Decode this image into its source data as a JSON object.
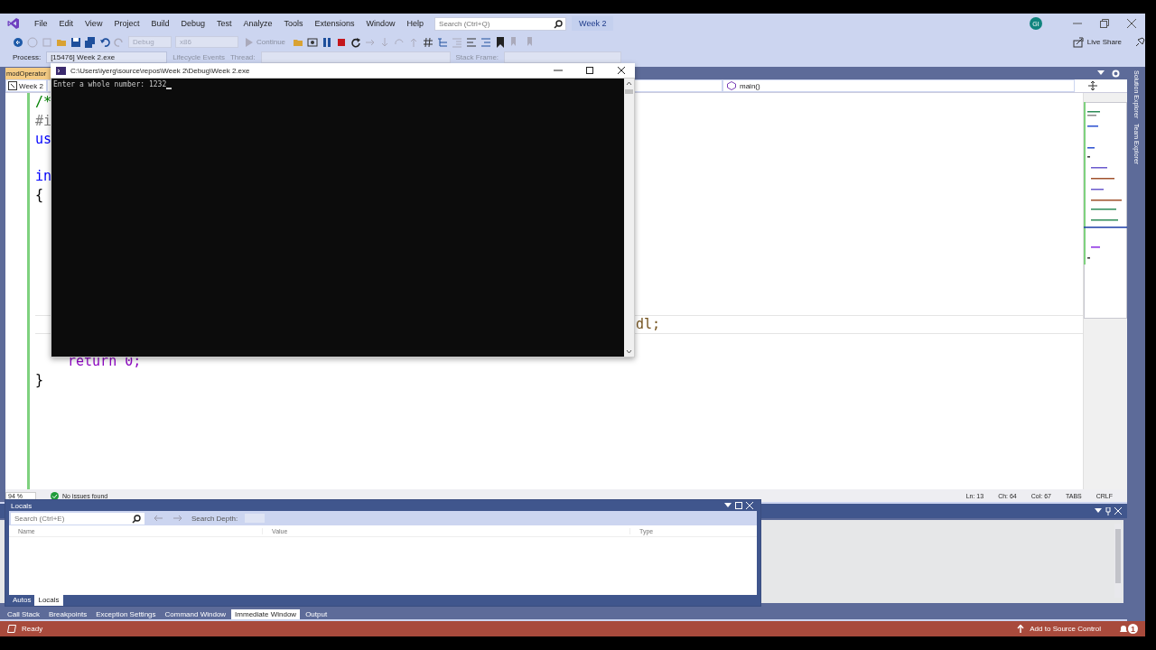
{
  "window": {
    "menu": [
      "File",
      "Edit",
      "View",
      "Project",
      "Build",
      "Debug",
      "Test",
      "Analyze",
      "Tools",
      "Extensions",
      "Window",
      "Help"
    ],
    "search": {
      "placeholder": "Search (Ctrl+Q)"
    },
    "solution_name": "Week 2",
    "account_initials": "GI"
  },
  "toolbar": {
    "configuration": "Debug",
    "platform": "x86",
    "continue": "Continue",
    "live_share": "Live Share"
  },
  "debug_location": {
    "process_label": "Process:",
    "process": "[15476] Week 2.exe",
    "lifecycle": "Lifecycle Events",
    "thread_label": "Thread:",
    "stack_frame_label": "Stack Frame:"
  },
  "document_tab": {
    "title": "modOperator",
    "selected": true
  },
  "navigation": {
    "project": "Week 2",
    "member": "main()"
  },
  "code_lines": [
    {
      "kind": "comment",
      "text": "/*"
    },
    {
      "kind": "preproc",
      "text": "#i"
    },
    {
      "kind": "keyword",
      "text": "us"
    },
    {
      "kind": "blank"
    },
    {
      "kind": "keyword",
      "text": "in"
    },
    {
      "kind": "plain",
      "text": "{"
    },
    {
      "kind": "blank"
    },
    {
      "kind": "blank"
    },
    {
      "kind": "blank"
    },
    {
      "kind": "blank"
    },
    {
      "kind": "blank"
    },
    {
      "kind": "blank"
    },
    {
      "kind": "tail",
      "text": "dl;",
      "current": true
    },
    {
      "kind": "blank"
    },
    {
      "kind": "control",
      "text": "return 0;"
    },
    {
      "kind": "plain",
      "text": "}"
    }
  ],
  "editor_status": {
    "zoom": "94 %",
    "issues": "No issues found",
    "line": "Ln: 13",
    "char": "Ch: 64",
    "column": "Col: 67",
    "indent": "TABS",
    "line_ending": "CRLF"
  },
  "side_tabs": [
    "Solution Explorer",
    "Team Explorer"
  ],
  "bottom_tabs": [
    {
      "label": "Call Stack",
      "selected": false
    },
    {
      "label": "Breakpoints",
      "selected": false
    },
    {
      "label": "Exception Settings",
      "selected": false
    },
    {
      "label": "Command Window",
      "selected": false
    },
    {
      "label": "Immediate Window",
      "selected": true
    },
    {
      "label": "Output",
      "selected": false
    }
  ],
  "locals_window": {
    "title": "Locals",
    "search_placeholder": "Search (Ctrl+E)",
    "search_depth_label": "Search Depth:",
    "columns": [
      "Name",
      "Value",
      "Type"
    ],
    "tabs": [
      {
        "label": "Autos",
        "selected": false
      },
      {
        "label": "Locals",
        "selected": true
      }
    ]
  },
  "console_window": {
    "title": "C:\\Users\\iyerg\\source\\repos\\Week 2\\Debug\\Week 2.exe",
    "output": "Enter a whole number: 1232"
  },
  "status_bar": {
    "state": "Ready",
    "source_control": "Add to Source Control",
    "notifications": "1"
  }
}
